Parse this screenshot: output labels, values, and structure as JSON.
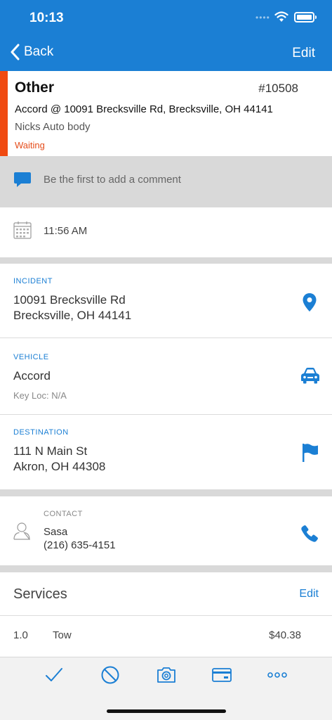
{
  "status_bar": {
    "time": "10:13",
    "signal_dots": "••••"
  },
  "nav": {
    "back_label": "Back",
    "edit_label": "Edit"
  },
  "job": {
    "type": "Other",
    "number": "#10508",
    "vehicle_location": "Accord @ 10091 Brecksville Rd, Brecksville, OH 44141",
    "account": "Nicks Auto body",
    "status": "Waiting"
  },
  "comment": {
    "placeholder": "Be the first to add a comment"
  },
  "schedule": {
    "time": "11:56 AM"
  },
  "incident": {
    "label": "INCIDENT",
    "line1": "10091 Brecksville Rd",
    "line2": "Brecksville, OH 44141"
  },
  "vehicle": {
    "label": "VEHICLE",
    "name": "Accord",
    "key_loc": "Key Loc: N/A"
  },
  "destination": {
    "label": "DESTINATION",
    "line1": "111 N Main St",
    "line2": "Akron, OH 44308"
  },
  "contact": {
    "label": "CONTACT",
    "name": "Sasa",
    "phone": "(216) 635-4151"
  },
  "services": {
    "title": "Services",
    "edit_label": "Edit",
    "items": [
      {
        "qty": "1.0",
        "name": "Tow",
        "price": "$40.38"
      }
    ]
  },
  "toolbar": {
    "items": [
      "check-icon",
      "cancel-icon",
      "camera-icon",
      "credit-card-icon",
      "more-icon"
    ]
  },
  "colors": {
    "accent": "#1b7fd4",
    "status_bar_red": "#f04a11",
    "waiting": "#e54d1b",
    "separator": "#d9d9d9"
  }
}
